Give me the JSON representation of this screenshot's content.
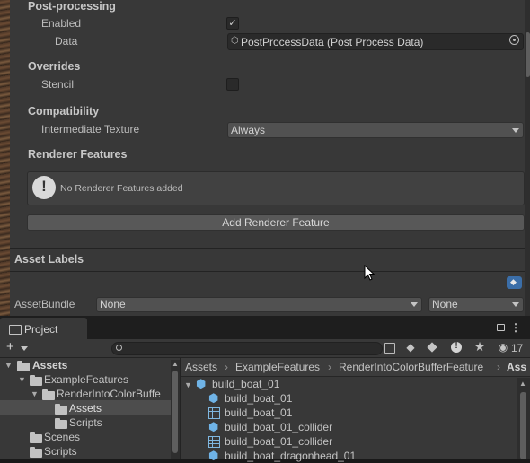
{
  "inspector": {
    "post_processing": {
      "title": "Post-processing",
      "enabled_label": "Enabled",
      "enabled_checked": true,
      "data_label": "Data",
      "data_value": "PostProcessData (Post Process Data)"
    },
    "overrides": {
      "title": "Overrides",
      "stencil_label": "Stencil",
      "stencil_checked": false
    },
    "compatibility": {
      "title": "Compatibility",
      "intermediate_texture_label": "Intermediate Texture",
      "intermediate_texture_value": "Always"
    },
    "renderer_features": {
      "title": "Renderer Features",
      "help_message": "No Renderer Features added",
      "add_button": "Add Renderer Feature"
    },
    "asset_labels": {
      "title": "Asset Labels",
      "assetbundle_label": "AssetBundle",
      "bundle_name_value": "None",
      "bundle_variant_value": "None"
    }
  },
  "project": {
    "tab_label": "Project",
    "add_label": "+",
    "search_placeholder": "",
    "hidden_packages_count": "17",
    "tree": [
      {
        "label": "Assets",
        "bold": true
      },
      {
        "label": "ExampleFeatures"
      },
      {
        "label": "RenderIntoColorBuffe"
      },
      {
        "label": "Assets",
        "selected": true
      },
      {
        "label": "Scripts"
      },
      {
        "label": "Scenes"
      },
      {
        "label": "Scripts"
      }
    ],
    "breadcrumb": [
      "Assets",
      "ExampleFeatures",
      "RenderIntoColorBufferFeature",
      "Ass"
    ],
    "files": [
      {
        "label": "build_boat_01",
        "icon": "prefab-icon"
      },
      {
        "label": "build_boat_01",
        "icon": "cube-icon"
      },
      {
        "label": "build_boat_01",
        "icon": "mesh-icon"
      },
      {
        "label": "build_boat_01_collider",
        "icon": "cube-icon"
      },
      {
        "label": "build_boat_01_collider",
        "icon": "mesh-icon"
      },
      {
        "label": "build_boat_dragonhead_01",
        "icon": "cube-icon"
      }
    ]
  },
  "colors": {
    "inspector_bg": "#383838",
    "accent_blue": "#6fb3e6",
    "selection": "#4d4d4d"
  }
}
